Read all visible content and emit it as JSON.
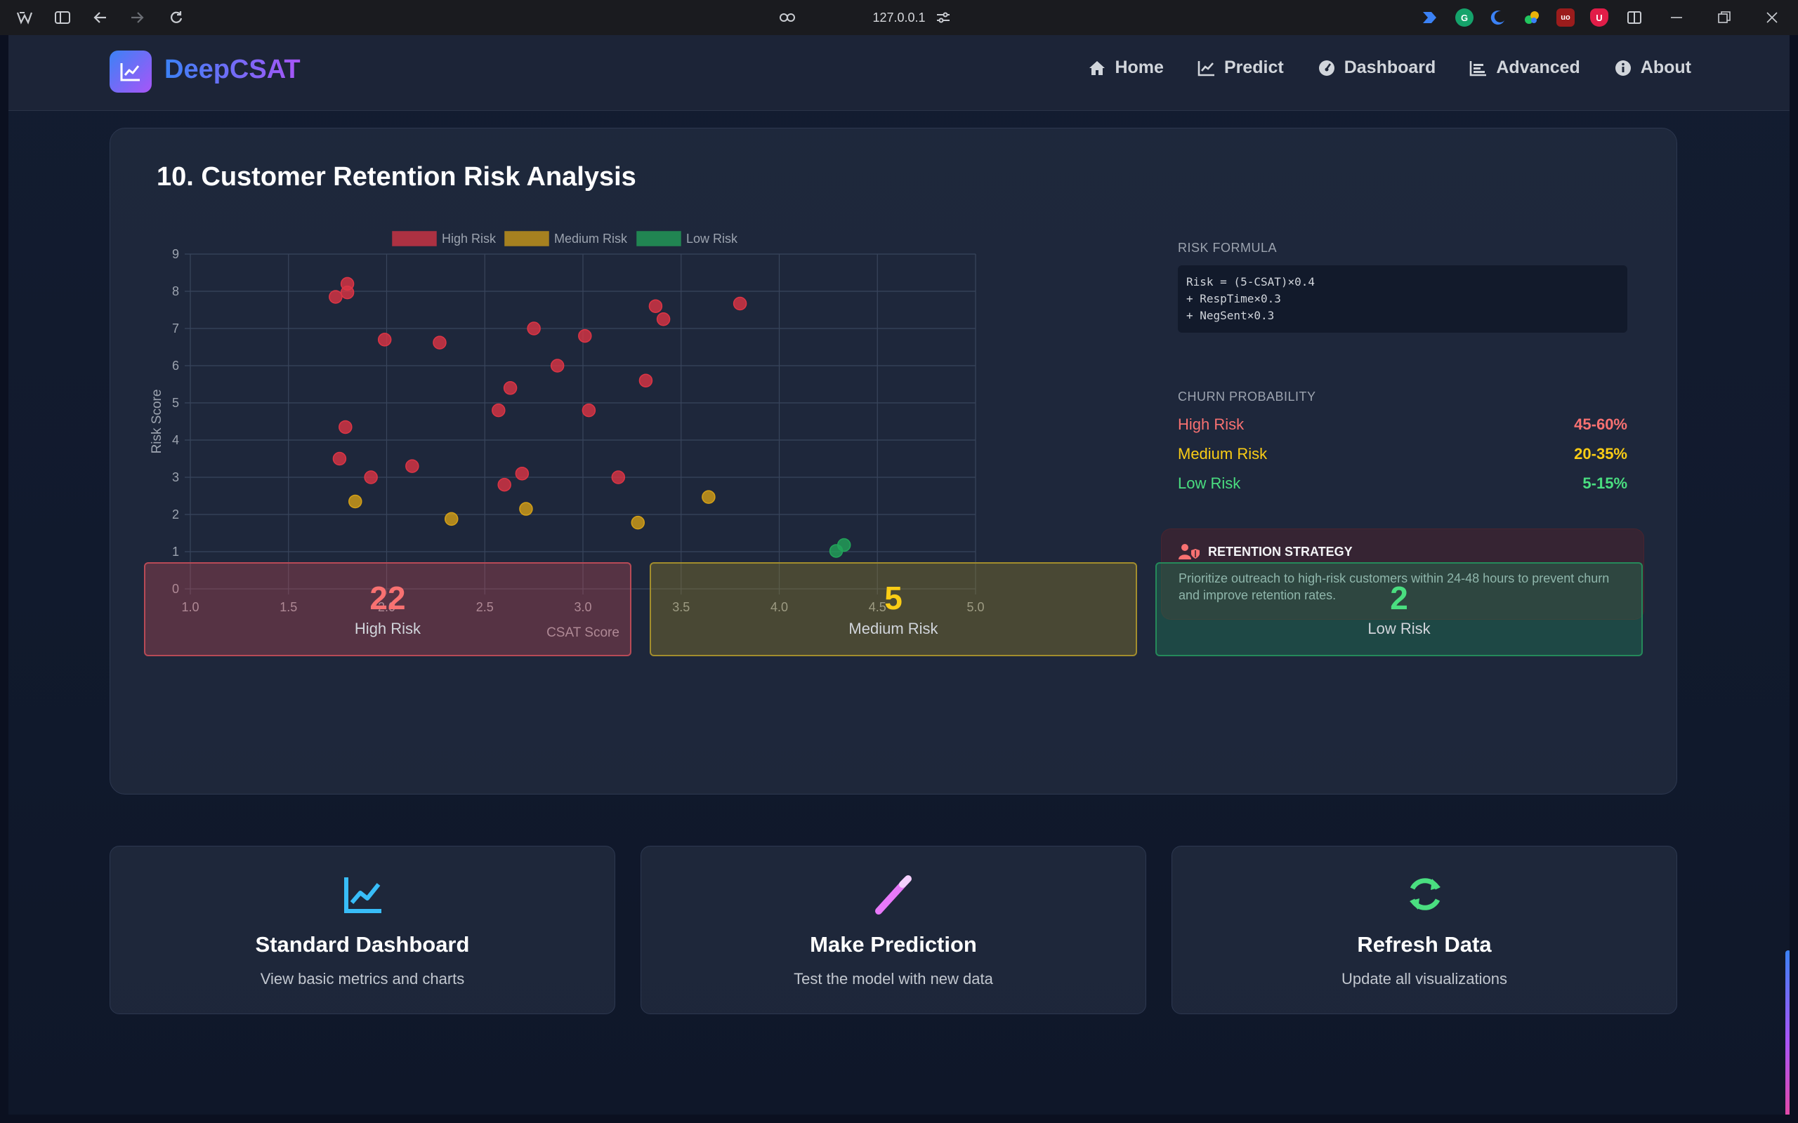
{
  "browser": {
    "url": "127.0.0.1"
  },
  "nav": {
    "brand": "DeepCSAT",
    "links": [
      {
        "label": "Home",
        "icon": "home-icon"
      },
      {
        "label": "Predict",
        "icon": "chart-line-icon"
      },
      {
        "label": "Dashboard",
        "icon": "gauge-icon"
      },
      {
        "label": "Advanced",
        "icon": "chart-bar-icon"
      },
      {
        "label": "About",
        "icon": "info-icon"
      }
    ]
  },
  "section": {
    "title": "10. Customer Retention Risk Analysis",
    "formula_label": "RISK FORMULA",
    "formula_lines": [
      "Risk = (5-CSAT)×0.4",
      "+ RespTime×0.3",
      "+ NegSent×0.3"
    ],
    "churn_label": "CHURN PROBABILITY",
    "churn": [
      {
        "label": "High Risk",
        "value": "45-60%",
        "color": "#f87171"
      },
      {
        "label": "Medium Risk",
        "value": "20-35%",
        "color": "#facc15"
      },
      {
        "label": "Low Risk",
        "value": "5-15%",
        "color": "#4ade80"
      }
    ],
    "strategy_title": "RETENTION STRATEGY",
    "strategy_text": "Prioritize outreach to high-risk customers within 24-48 hours to prevent churn and improve retention rates.",
    "cards": [
      {
        "num": "22",
        "label": "High Risk",
        "color": "#f87171",
        "bg": "rgba(220, 80, 90, 0.32)",
        "border": "#b84a56"
      },
      {
        "num": "5",
        "label": "Medium Risk",
        "color": "#facc15",
        "bg": "rgba(160, 140, 40, 0.35)",
        "border": "#a28d2d"
      },
      {
        "num": "2",
        "label": "Low Risk",
        "color": "#4ade80",
        "bg": "rgba(30, 140, 90, 0.35)",
        "border": "#258a5a"
      }
    ]
  },
  "actions": [
    {
      "title": "Standard Dashboard",
      "subtitle": "View basic metrics and charts",
      "icon": "chart-line-icon",
      "color": "#38bdf8"
    },
    {
      "title": "Make Prediction",
      "subtitle": "Test the model with new data",
      "icon": "magic-wand-icon",
      "color": "#e879f9"
    },
    {
      "title": "Refresh Data",
      "subtitle": "Update all visualizations",
      "icon": "refresh-icon",
      "color": "#4ade80"
    }
  ],
  "chart_data": {
    "type": "scatter",
    "title": "",
    "xlabel": "CSAT Score",
    "ylabel": "Risk Score",
    "xlim": [
      1.0,
      5.0
    ],
    "ylim": [
      0,
      9
    ],
    "xticks": [
      "1.0",
      "1.5",
      "2.0",
      "2.5",
      "3.0",
      "3.5",
      "4.0",
      "4.5",
      "5.0"
    ],
    "yticks": [
      "0",
      "1",
      "2",
      "3",
      "4",
      "5",
      "6",
      "7",
      "8",
      "9"
    ],
    "grid": true,
    "legend_position": "top",
    "series": [
      {
        "name": "High Risk",
        "color": "#dc3545",
        "points": [
          [
            1.74,
            7.85
          ],
          [
            1.8,
            8.2
          ],
          [
            1.8,
            7.97
          ],
          [
            1.99,
            6.7
          ],
          [
            2.27,
            6.62
          ],
          [
            2.75,
            7.0
          ],
          [
            3.01,
            6.8
          ],
          [
            3.37,
            7.6
          ],
          [
            3.41,
            7.25
          ],
          [
            3.8,
            7.67
          ],
          [
            2.87,
            6.0
          ],
          [
            2.63,
            5.4
          ],
          [
            2.57,
            4.8
          ],
          [
            3.03,
            4.8
          ],
          [
            3.32,
            5.6
          ],
          [
            1.79,
            4.35
          ],
          [
            1.76,
            3.5
          ],
          [
            1.92,
            3.0
          ],
          [
            2.13,
            3.3
          ],
          [
            2.69,
            3.1
          ],
          [
            2.6,
            2.8
          ],
          [
            3.18,
            3.0
          ]
        ]
      },
      {
        "name": "Medium Risk",
        "color": "#d4a017",
        "points": [
          [
            1.84,
            2.35
          ],
          [
            2.33,
            1.88
          ],
          [
            2.71,
            2.15
          ],
          [
            3.28,
            1.78
          ],
          [
            3.64,
            2.47
          ]
        ]
      },
      {
        "name": "Low Risk",
        "color": "#22a55a",
        "points": [
          [
            4.29,
            1.02
          ],
          [
            4.33,
            1.18
          ]
        ]
      }
    ]
  }
}
